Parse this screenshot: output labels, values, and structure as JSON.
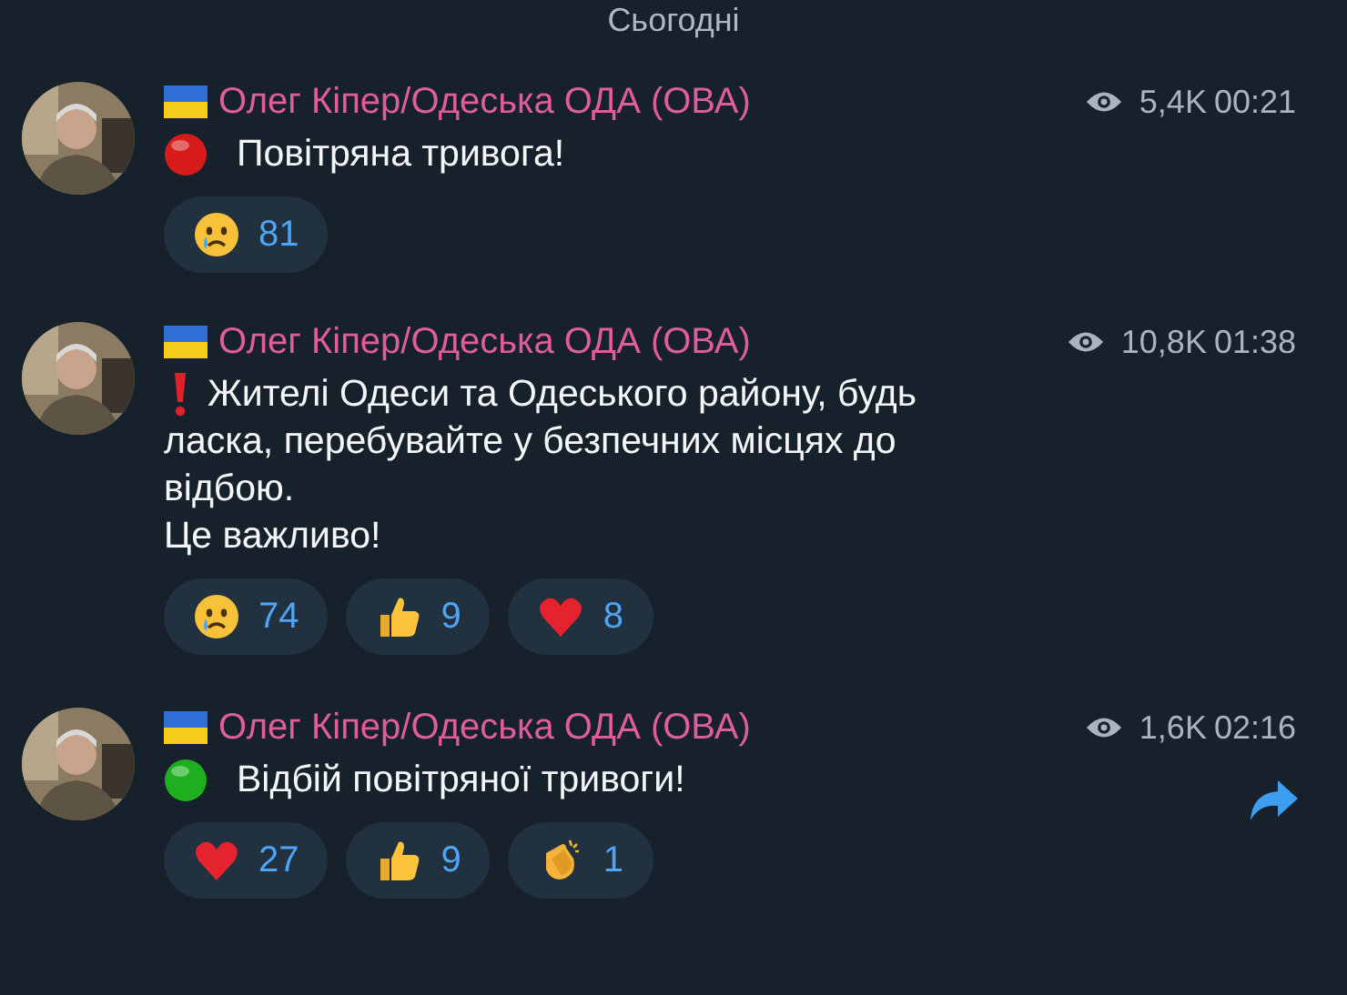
{
  "date_label": "Сьогодні",
  "messages": [
    {
      "author": "Олег Кіпер/Одеська ОДА (ОВА)",
      "views": "5,4K",
      "time": "00:21",
      "kind": "alarm",
      "lines": [
        "Повітряна тривога!"
      ],
      "forward": false,
      "reactions": [
        {
          "kind": "cry",
          "count": "81"
        }
      ]
    },
    {
      "author": "Олег Кіпер/Одеська ОДА (ОВА)",
      "views": "10,8K",
      "time": "01:38",
      "kind": "warning",
      "lines": [
        "Жителі Одеси та Одеського району, будь",
        "ласка, перебувайте у безпечних місцях до",
        "відбою.",
        "Це важливо!"
      ],
      "forward": false,
      "reactions": [
        {
          "kind": "cry",
          "count": "74"
        },
        {
          "kind": "thumbs",
          "count": "9"
        },
        {
          "kind": "heart",
          "count": "8"
        }
      ]
    },
    {
      "author": "Олег Кіпер/Одеська ОДА (ОВА)",
      "views": "1,6K",
      "time": "02:16",
      "kind": "all_clear",
      "lines": [
        "Відбій повітряної тривоги!"
      ],
      "forward": true,
      "reactions": [
        {
          "kind": "heart",
          "count": "27"
        },
        {
          "kind": "thumbs",
          "count": "9"
        },
        {
          "kind": "clap",
          "count": "1"
        }
      ]
    }
  ]
}
